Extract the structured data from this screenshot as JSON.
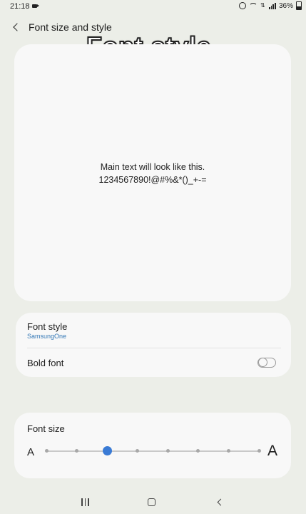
{
  "status_bar": {
    "time": "21:18",
    "battery": "36%"
  },
  "header": {
    "title": "Font size and style",
    "overlay_caption": "Font style"
  },
  "preview": {
    "line1": "Main text will look like this.",
    "line2": "1234567890!@#%&*()_+-="
  },
  "settings": {
    "font_style": {
      "label": "Font style",
      "value": "SamsungOne"
    },
    "bold_font": {
      "label": "Bold font",
      "enabled": false
    }
  },
  "font_size": {
    "label": "Font size",
    "small_glyph": "A",
    "large_glyph": "A",
    "steps": 8,
    "selected_step": 3
  },
  "colors": {
    "accent": "#3a7bd5",
    "sub_text": "#3478b6",
    "background": "#eceee8",
    "card": "#f8f8f8"
  }
}
